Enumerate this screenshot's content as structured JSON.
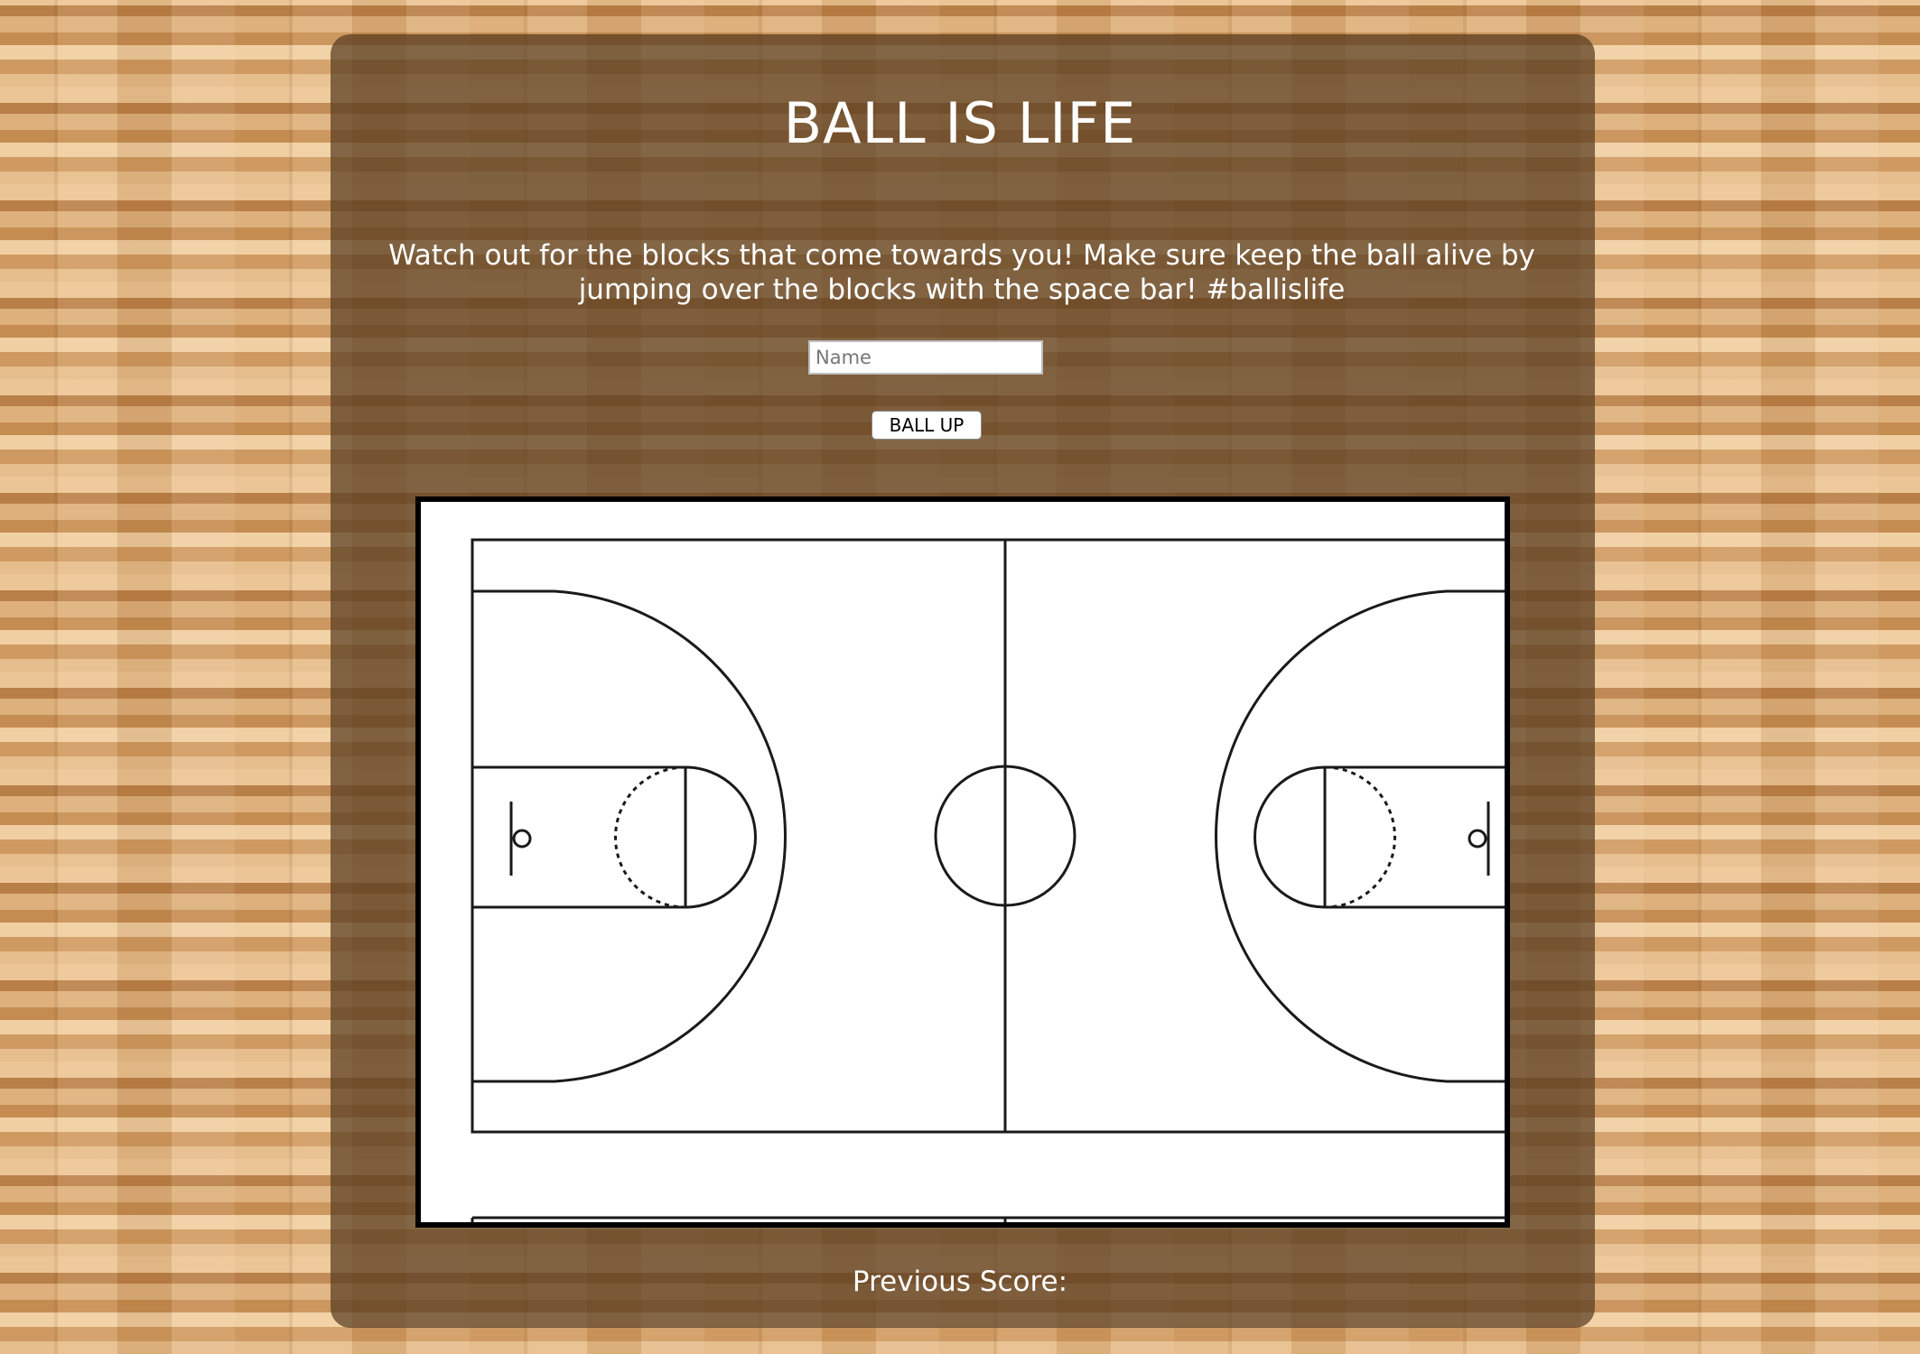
{
  "title": "BALL IS LIFE",
  "instructions": "Watch out for the blocks that come towards you! Make sure keep the ball alive by jumping over the blocks with the space bar! #ballislife",
  "name_input": {
    "placeholder": "Name",
    "value": ""
  },
  "start_button": {
    "label": "BALL UP"
  },
  "previous_score": {
    "label": "Previous Score:",
    "value": ""
  },
  "colors": {
    "panel": "#58391f",
    "text": "#ffffff",
    "court_lines": "#1a1a1a",
    "court_bg": "#ffffff",
    "frame_border": "#000000"
  },
  "icons": [
    "basketball-court-illustration"
  ]
}
